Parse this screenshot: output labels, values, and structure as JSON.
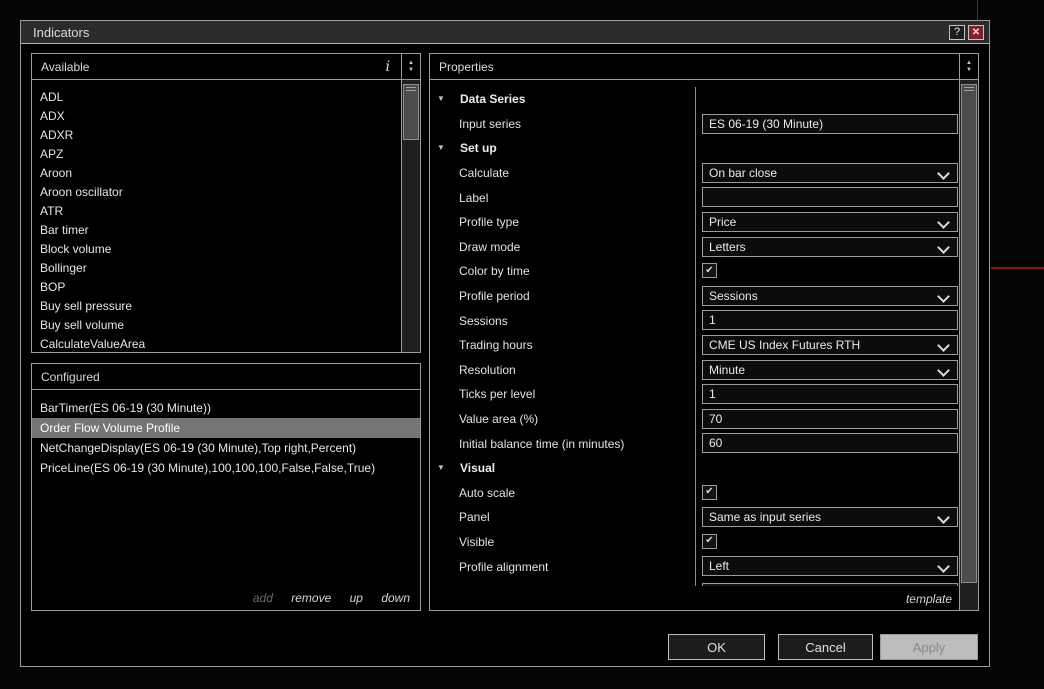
{
  "window": {
    "title": "Indicators"
  },
  "icons": {
    "help": "?",
    "close": "✕",
    "info": "i",
    "spinner_up": "▲",
    "spinner_down": "▼",
    "section_expanded": "▼",
    "checkbox_check": "✔"
  },
  "available": {
    "header": "Available",
    "items": [
      "ADL",
      "ADX",
      "ADXR",
      "APZ",
      "Aroon",
      "Aroon oscillator",
      "ATR",
      "Bar timer",
      "Block volume",
      "Bollinger",
      "BOP",
      "Buy sell pressure",
      "Buy sell volume",
      "CalculateValueArea"
    ]
  },
  "configured": {
    "header": "Configured",
    "selected_index": 1,
    "items": [
      "BarTimer(ES 06-19 (30 Minute))",
      "Order Flow Volume Profile",
      "NetChangeDisplay(ES 06-19 (30 Minute),Top right,Percent)",
      "PriceLine(ES 06-19 (30 Minute),100,100,100,False,False,True)"
    ],
    "actions": [
      {
        "label": "add",
        "enabled": false
      },
      {
        "label": "remove",
        "enabled": true
      },
      {
        "label": "up",
        "enabled": true
      },
      {
        "label": "down",
        "enabled": true
      }
    ]
  },
  "properties": {
    "header": "Properties",
    "footer_link": "template",
    "rows": [
      {
        "type": "section",
        "label": "Data Series"
      },
      {
        "type": "text",
        "label": "Input series",
        "value": "ES 06-19 (30 Minute)"
      },
      {
        "type": "section",
        "label": "Set up"
      },
      {
        "type": "select",
        "label": "Calculate",
        "value": "On bar close"
      },
      {
        "type": "text",
        "label": "Label",
        "value": ""
      },
      {
        "type": "select",
        "label": "Profile type",
        "value": "Price"
      },
      {
        "type": "select",
        "label": "Draw mode",
        "value": "Letters"
      },
      {
        "type": "checkbox",
        "label": "Color by time",
        "value": true
      },
      {
        "type": "select",
        "label": "Profile period",
        "value": "Sessions"
      },
      {
        "type": "text",
        "label": "Sessions",
        "value": "1"
      },
      {
        "type": "select",
        "label": "Trading hours",
        "value": "CME US Index Futures RTH"
      },
      {
        "type": "select",
        "label": "Resolution",
        "value": "Minute"
      },
      {
        "type": "text",
        "label": "Ticks per level",
        "value": "1"
      },
      {
        "type": "text",
        "label": "Value area (%)",
        "value": "70"
      },
      {
        "type": "text",
        "label": "Initial balance time (in minutes)",
        "value": "60"
      },
      {
        "type": "section",
        "label": "Visual"
      },
      {
        "type": "checkbox",
        "label": "Auto scale",
        "value": true
      },
      {
        "type": "select",
        "label": "Panel",
        "value": "Same as input series"
      },
      {
        "type": "checkbox",
        "label": "Visible",
        "value": true
      },
      {
        "type": "select",
        "label": "Profile alignment",
        "value": "Left"
      },
      {
        "type": "partial",
        "label": "",
        "value": ""
      }
    ]
  },
  "buttons": [
    {
      "label": "OK",
      "enabled": true
    },
    {
      "label": "Cancel",
      "enabled": true
    },
    {
      "label": "Apply",
      "enabled": false
    }
  ],
  "colors": {
    "titlebar_bg": "#2b2b2b",
    "dialog_bg": "#000000",
    "panel_border": "#9b9b9b",
    "selected_item_bg": "#757575",
    "close_button_bg": "#7d2328",
    "crosshair_red": "#8e1313",
    "disabled_button_bg": "#bdbdbd"
  }
}
